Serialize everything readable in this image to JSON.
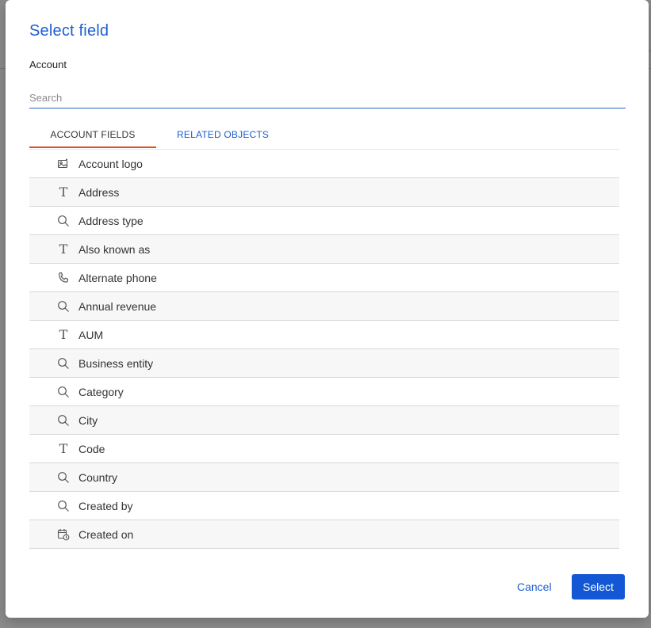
{
  "dialog": {
    "title": "Select field",
    "object_label": "Account",
    "search": {
      "placeholder": "Search",
      "value": ""
    },
    "tabs": [
      {
        "label": "ACCOUNT FIELDS",
        "active": true
      },
      {
        "label": "RELATED OBJECTS",
        "active": false
      }
    ],
    "fields": [
      {
        "label": "Account logo",
        "icon": "image-icon"
      },
      {
        "label": "Address",
        "icon": "text-icon"
      },
      {
        "label": "Address type",
        "icon": "lookup-icon"
      },
      {
        "label": "Also known as",
        "icon": "text-icon"
      },
      {
        "label": "Alternate phone",
        "icon": "phone-icon"
      },
      {
        "label": "Annual revenue",
        "icon": "lookup-icon"
      },
      {
        "label": "AUM",
        "icon": "text-icon"
      },
      {
        "label": "Business entity",
        "icon": "lookup-icon"
      },
      {
        "label": "Category",
        "icon": "lookup-icon"
      },
      {
        "label": "City",
        "icon": "lookup-icon"
      },
      {
        "label": "Code",
        "icon": "text-icon"
      },
      {
        "label": "Country",
        "icon": "lookup-icon"
      },
      {
        "label": "Created by",
        "icon": "lookup-icon"
      },
      {
        "label": "Created on",
        "icon": "datetime-icon"
      }
    ],
    "buttons": {
      "cancel": "Cancel",
      "select": "Select"
    }
  },
  "colors": {
    "accent": "#1d5fd0",
    "primary_button": "#1457d4",
    "active_tab_underline": "#e04b1f"
  }
}
